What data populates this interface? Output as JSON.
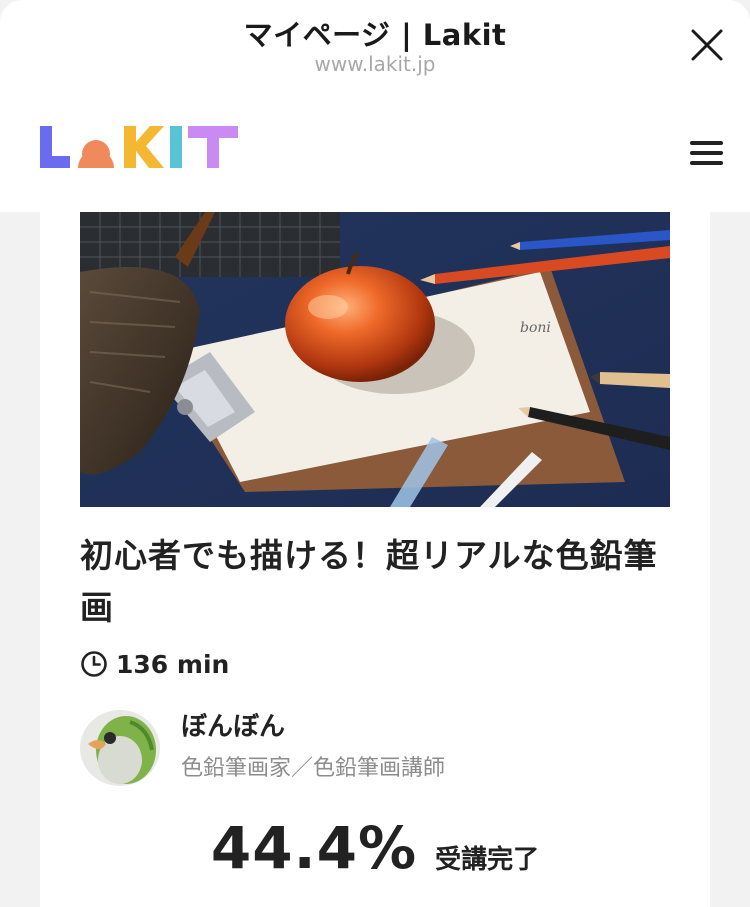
{
  "header": {
    "title": "マイページ | Lakit",
    "url": "www.lakit.jp"
  },
  "site": {
    "logo_text": "LaKIT",
    "logo_colors": [
      "#6b6bf0",
      "#f08a5d",
      "#f4b731",
      "#58c4d6",
      "#c98af2"
    ]
  },
  "course": {
    "title": "初心者でも描ける！超リアルな色鉛筆画",
    "duration": "136 min",
    "instructor": {
      "name": "ぼんぼん",
      "role": "色鉛筆画家／色鉛筆画講師"
    },
    "progress_percent": "44.4%",
    "progress_label": "受講完了"
  },
  "icons": {
    "close": "close-icon",
    "menu": "hamburger-menu-icon",
    "clock": "clock-icon"
  }
}
